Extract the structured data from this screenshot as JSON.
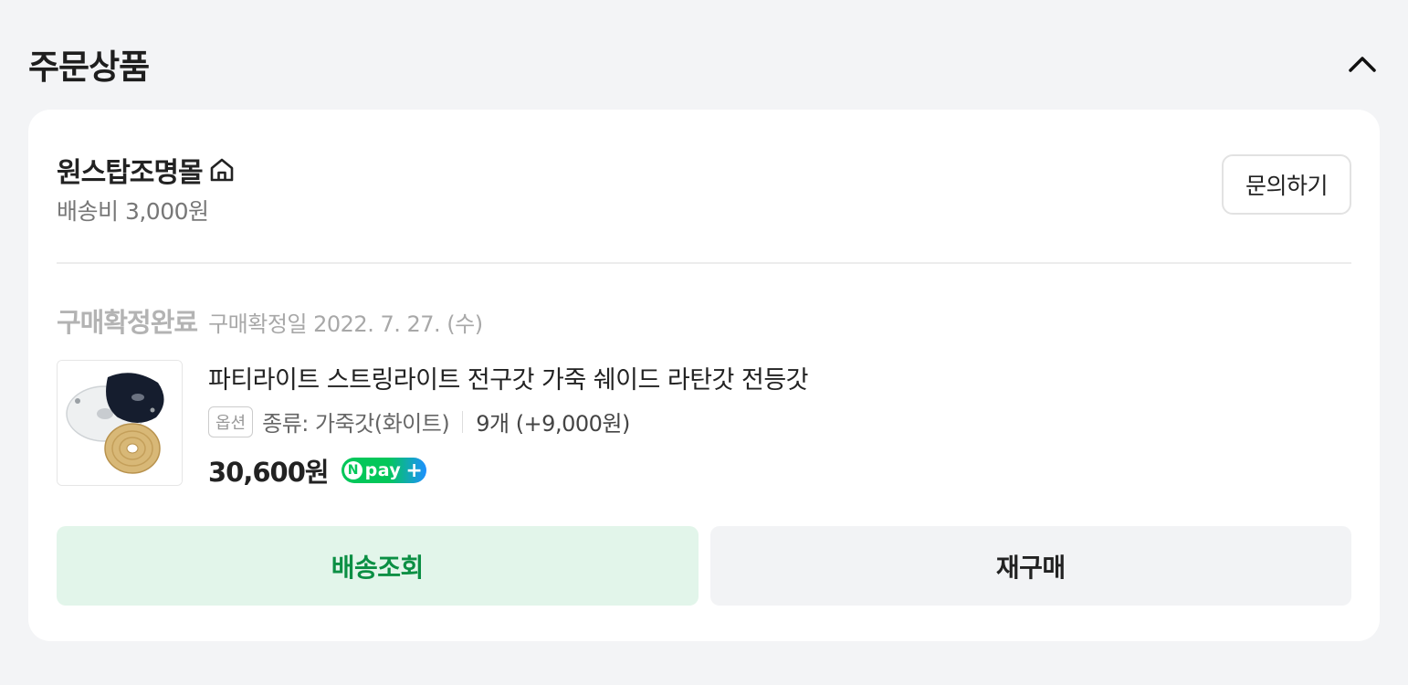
{
  "section": {
    "title": "주문상품"
  },
  "seller": {
    "name": "원스탑조명몰",
    "shipping_fee": "배송비 3,000원",
    "inquiry_label": "문의하기"
  },
  "order": {
    "status": "구매확정완료",
    "confirmed_date": "구매확정일 2022. 7. 27. (수)"
  },
  "product": {
    "name": "파티라이트 스트링라이트 전구갓 가죽 쉐이드 라탄갓 전등갓",
    "option_badge": "옵션",
    "option_value": "종류: 가죽갓(화이트)",
    "quantity": "9개 (+9,000원)",
    "price": "30,600원",
    "npay_n": "N",
    "npay_text": "pay",
    "npay_plus": "+"
  },
  "actions": {
    "track_label": "배송조회",
    "rebuy_label": "재구매"
  },
  "colors": {
    "accent_green": "#0b8f44",
    "track_bg": "#e2f5ea",
    "page_bg": "#f3f4f6"
  },
  "icons": {
    "collapse": "chevron-up-icon",
    "store_home": "home-icon"
  }
}
